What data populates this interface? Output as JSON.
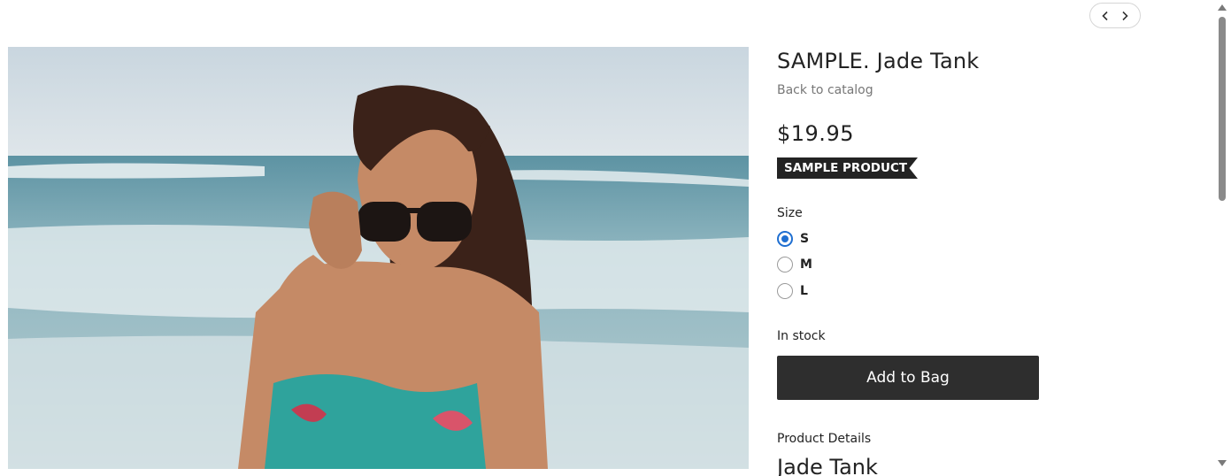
{
  "nav": {
    "prev_icon": "chevron-left-icon",
    "next_icon": "chevron-right-icon"
  },
  "product": {
    "image_icon": "product-photo",
    "title": "SAMPLE. Jade Tank",
    "back_link": "Back to catalog",
    "price": "$19.95",
    "ribbon": "SAMPLE PRODUCT",
    "size_label": "Size",
    "sizes": [
      {
        "label": "S",
        "selected": true
      },
      {
        "label": "M",
        "selected": false
      },
      {
        "label": "L",
        "selected": false
      }
    ],
    "stock": "In stock",
    "add_button": "Add to Bag",
    "details_label": "Product Details",
    "details_heading": "Jade Tank"
  },
  "colors": {
    "accent": "#1f6fd1",
    "button": "#2e2e2e",
    "ribbon": "#232323"
  }
}
